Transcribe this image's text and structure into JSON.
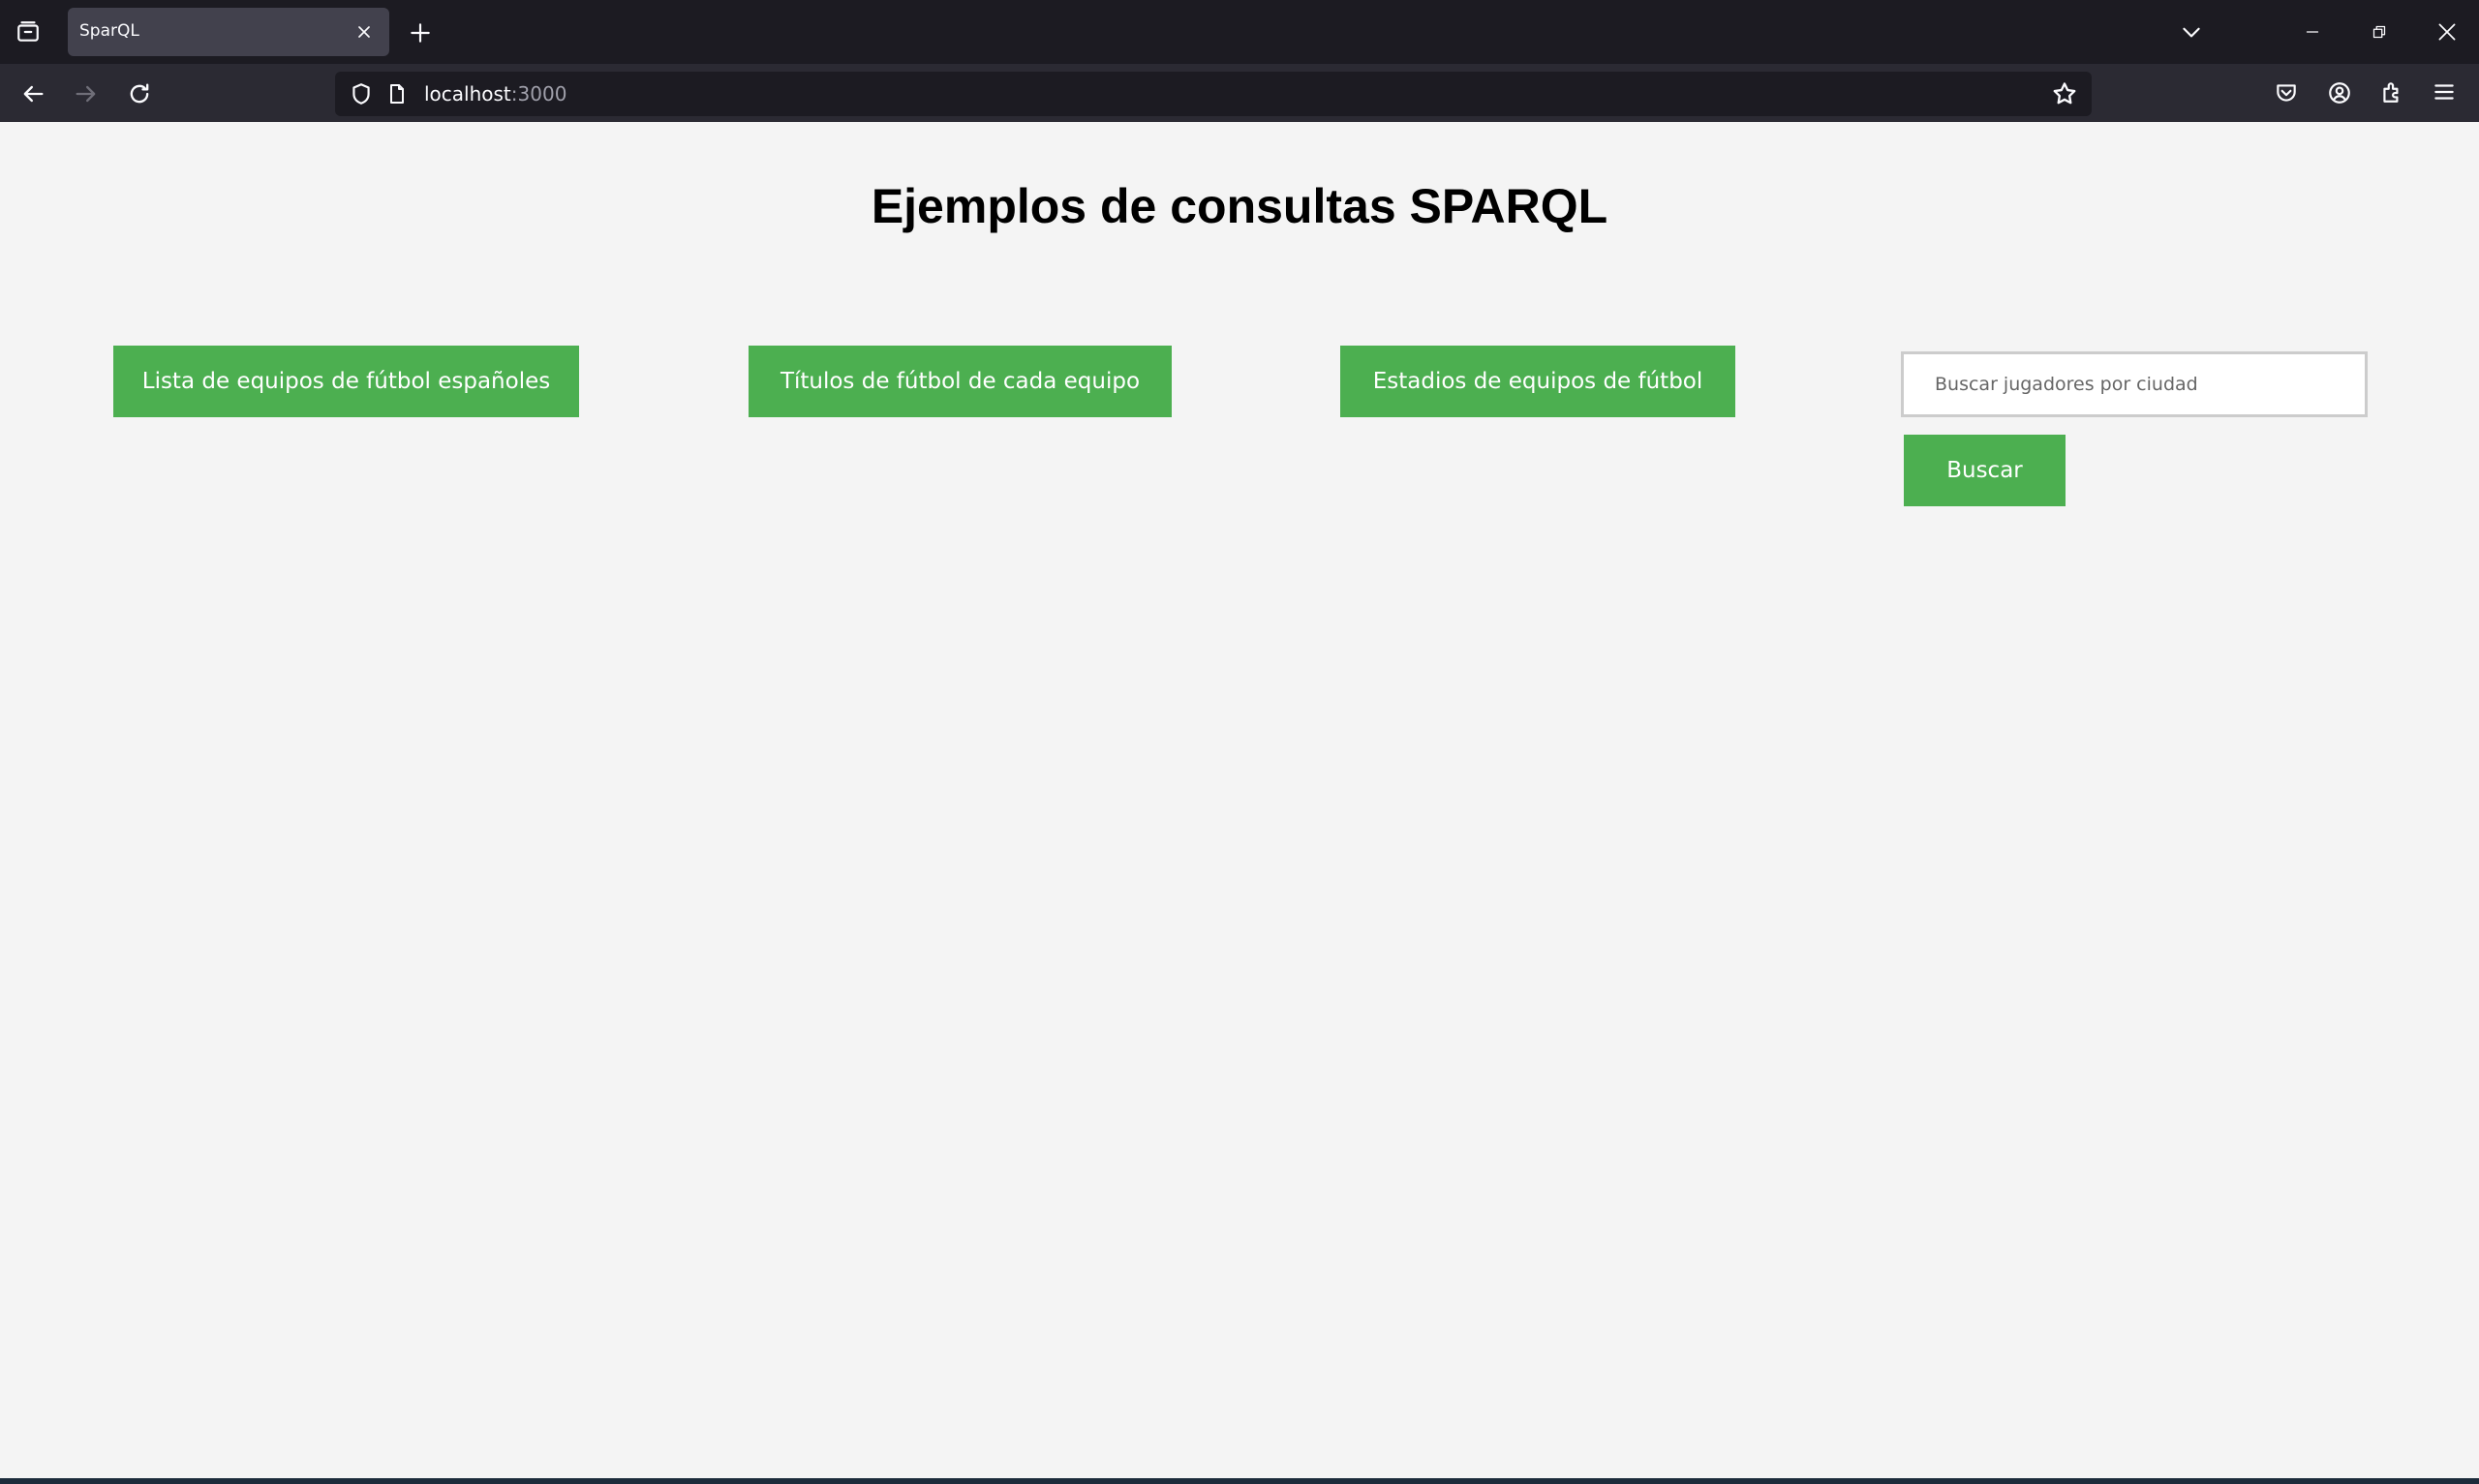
{
  "browser": {
    "tab_title": "SparQL",
    "url_host": "localhost",
    "url_port": ":3000"
  },
  "page": {
    "title": "Ejemplos de consultas SPARQL",
    "buttons": {
      "spanish_teams": "Lista de equipos de fútbol españoles",
      "titles_per_team": "Títulos de fútbol de cada equipo",
      "stadiums": "Estadios de equipos de fútbol"
    },
    "search": {
      "placeholder": "Buscar jugadores por ciudad",
      "value": "",
      "button_label": "Buscar"
    }
  },
  "colors": {
    "button": "#4caf50",
    "page_background": "#f4f4f4",
    "chrome_dark": "#1c1b22",
    "toolbar": "#2b2a33"
  },
  "icons": [
    "tab-list-icon",
    "close-tab-icon",
    "new-tab-icon",
    "tab-overflow-icon",
    "minimize-icon",
    "restore-icon",
    "close-window-icon",
    "back-icon",
    "forward-icon",
    "reload-icon",
    "shield-icon",
    "page-icon",
    "bookmark-star-icon",
    "pocket-icon",
    "account-icon",
    "extensions-icon",
    "menu-icon"
  ]
}
